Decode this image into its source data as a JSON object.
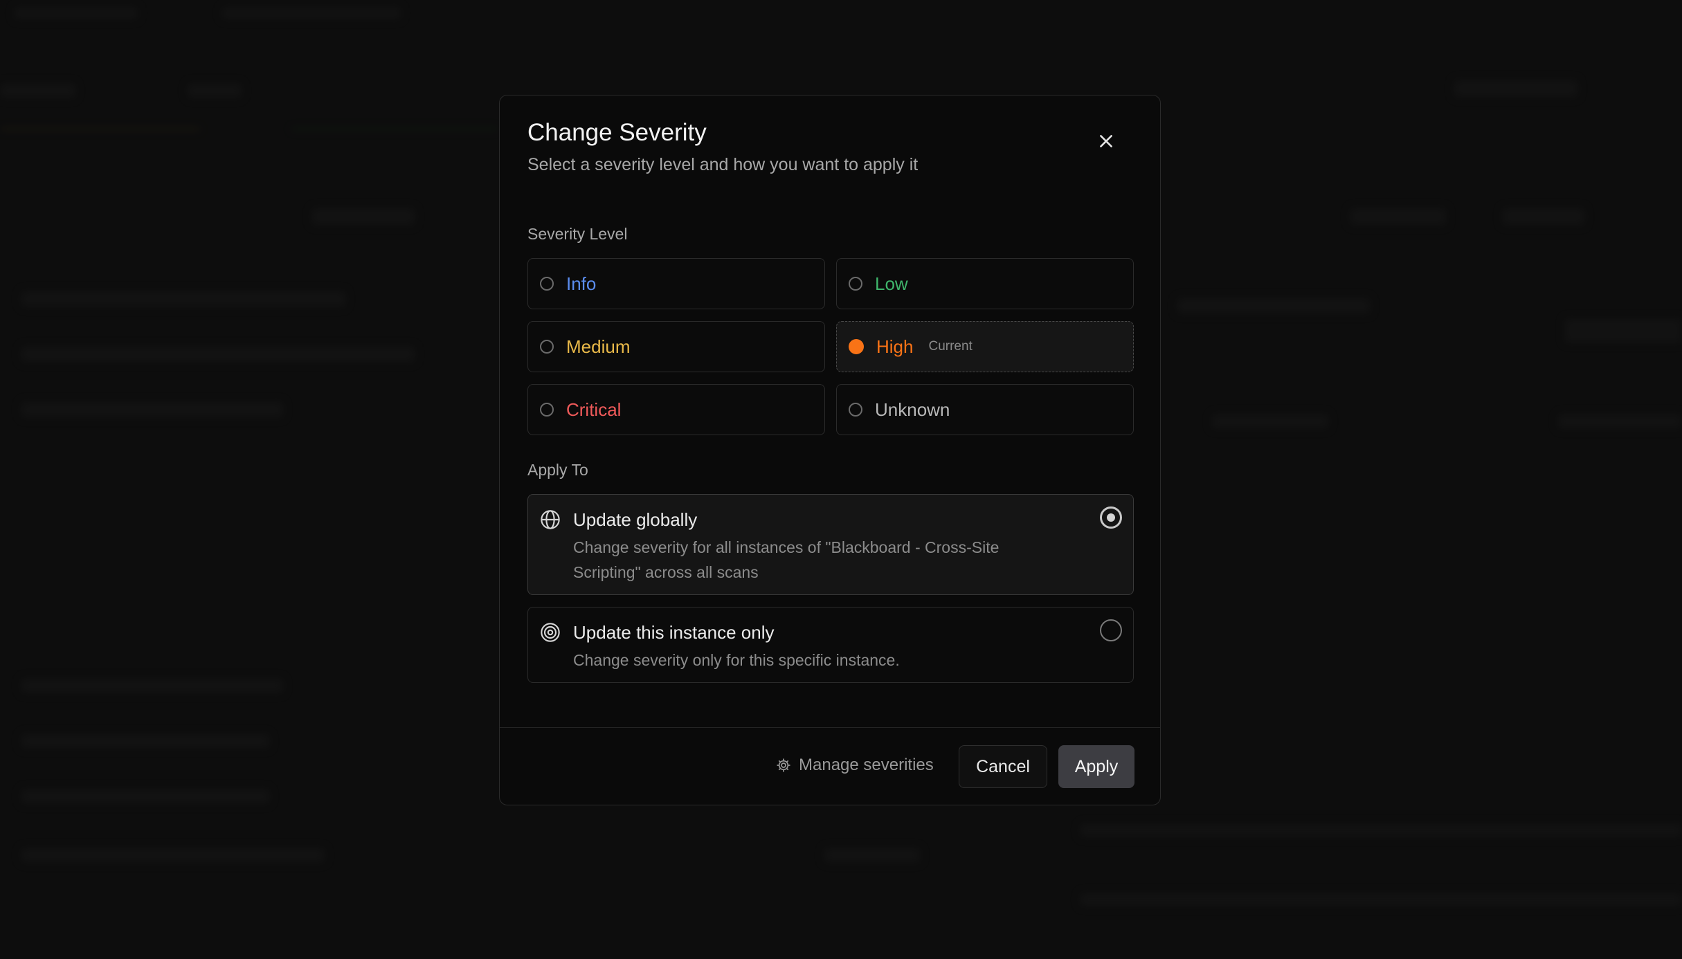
{
  "dialog": {
    "title": "Change Severity",
    "subtitle": "Select a severity level and how you want to apply it",
    "severity_label": "Severity Level",
    "severities": [
      {
        "label": "Info",
        "color": "#5b8def",
        "selected": false,
        "current": false
      },
      {
        "label": "Low",
        "color": "#3fb56b",
        "selected": false,
        "current": false
      },
      {
        "label": "Medium",
        "color": "#e9b949",
        "selected": false,
        "current": false
      },
      {
        "label": "High",
        "color": "#f97316",
        "selected": true,
        "current": true
      },
      {
        "label": "Critical",
        "color": "#ef5a5a",
        "selected": false,
        "current": false
      },
      {
        "label": "Unknown",
        "color": "#b8b8b8",
        "selected": false,
        "current": false
      }
    ],
    "current_tag": "Current",
    "apply_label": "Apply To",
    "apply_options": [
      {
        "title": "Update globally",
        "description": "Change severity for all instances of \"Blackboard - Cross-Site Scripting\" across all scans",
        "icon": "globe-icon",
        "selected": true
      },
      {
        "title": "Update this instance only",
        "description": "Change severity only for this specific instance.",
        "icon": "target-icon",
        "selected": false
      }
    ],
    "footer": {
      "manage_label": "Manage severities",
      "cancel_label": "Cancel",
      "apply_label": "Apply"
    }
  }
}
